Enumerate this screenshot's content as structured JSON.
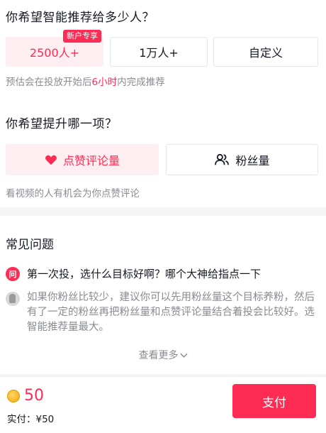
{
  "section_recommend": {
    "title": "你希望智能推荐给多少人？",
    "options": [
      {
        "label": "2500人+",
        "selected": true,
        "badge": "新户专享"
      },
      {
        "label": "1万人+",
        "selected": false
      },
      {
        "label": "自定义",
        "selected": false
      }
    ],
    "hint_prefix": "预估会在投放开始后",
    "hint_highlight": "6小时",
    "hint_suffix": "内完成推荐"
  },
  "section_goal": {
    "title": "你希望提升哪一项？",
    "options": [
      {
        "label": "点赞评论量",
        "icon": "heart-icon",
        "selected": true
      },
      {
        "label": "粉丝量",
        "icon": "users-icon",
        "selected": false
      }
    ],
    "hint": "看视频的人有机会为你点赞评论"
  },
  "faq": {
    "title": "常见问题",
    "question_badge": "问",
    "question": "第一次投，选什么目标好啊？哪个大神给指点一下",
    "answer": "如果你粉丝比较少，建议你可以先用粉丝量这个目标养粉，然后有了一定的粉丝再把粉丝量和点赞评论量结合着投会比较好。选智能推荐量最大。",
    "more": "查看更多"
  },
  "footer": {
    "price": "50",
    "actual": "实付：¥50",
    "pay": "支付"
  },
  "colors": {
    "accent": "#fe2c55",
    "accent_bg": "#fdeff1",
    "muted": "#8a8b91"
  }
}
